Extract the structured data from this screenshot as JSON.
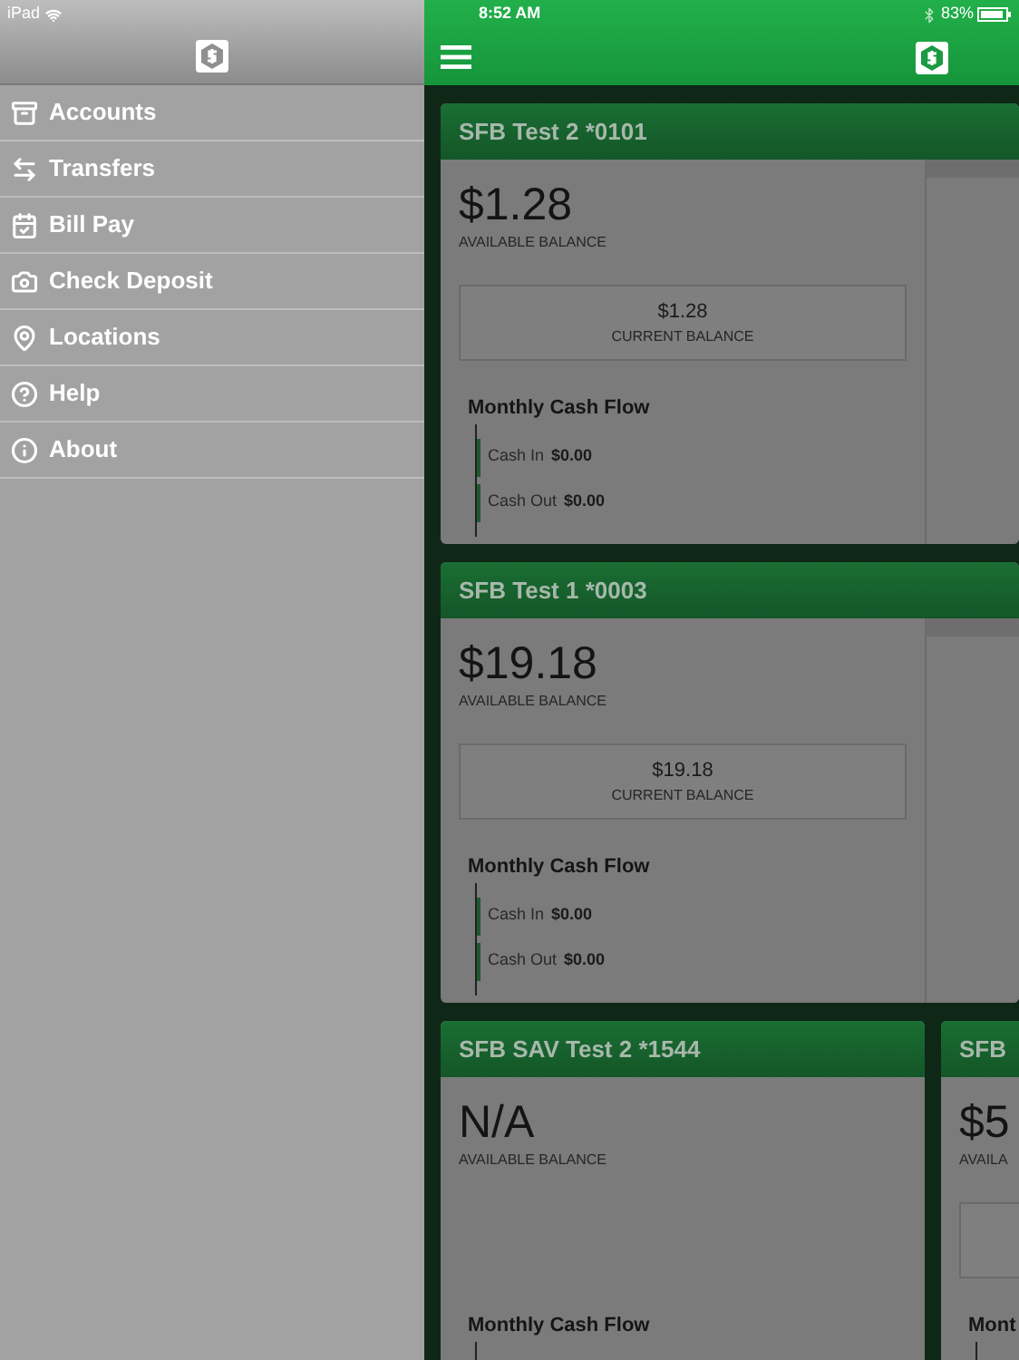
{
  "status_bar": {
    "device": "iPad",
    "time": "8:52 AM",
    "battery": "83%"
  },
  "sidebar": {
    "items": [
      {
        "label": "Accounts"
      },
      {
        "label": "Transfers"
      },
      {
        "label": "Bill Pay"
      },
      {
        "label": "Check Deposit"
      },
      {
        "label": "Locations"
      },
      {
        "label": "Help"
      },
      {
        "label": "About"
      }
    ]
  },
  "account_rows": [
    [
      {
        "kind": "wide",
        "title": "SFB Test 2 *0101",
        "available": "$1.28",
        "available_label": "AVAILABLE BALANCE",
        "current": "$1.28",
        "current_label": "CURRENT BALANCE",
        "cash_flow": {
          "title": "Monthly Cash Flow",
          "rows": [
            {
              "label": "Cash In",
              "value": "$0.00"
            },
            {
              "label": "Cash Out",
              "value": "$0.00"
            }
          ]
        }
      }
    ],
    [
      {
        "kind": "wide",
        "title": "SFB Test 1 *0003",
        "available": "$19.18",
        "available_label": "AVAILABLE BALANCE",
        "current": "$19.18",
        "current_label": "CURRENT BALANCE",
        "cash_flow": {
          "title": "Monthly Cash Flow",
          "rows": [
            {
              "label": "Cash In",
              "value": "$0.00"
            },
            {
              "label": "Cash Out",
              "value": "$0.00"
            }
          ]
        }
      }
    ],
    [
      {
        "kind": "narrow",
        "title": "SFB SAV Test 2 *1544",
        "available": "N/A",
        "available_label": "AVAILABLE BALANCE",
        "cash_flow": {
          "title": "Monthly Cash Flow"
        }
      },
      {
        "kind": "partial",
        "title": "SFB",
        "available": "$5",
        "available_label": "AVAILA",
        "current_box": true,
        "cash_flow": {
          "title": "Mont"
        }
      }
    ]
  ]
}
